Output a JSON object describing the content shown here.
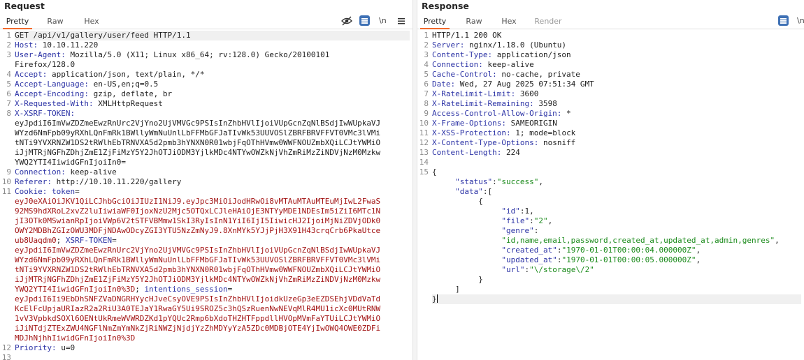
{
  "request": {
    "title": "Request",
    "tabs": [
      "Pretty",
      "Raw",
      "Hex"
    ],
    "active_tab": "Pretty",
    "tools": {
      "newline_label": "\\n"
    },
    "lines": [
      {
        "n": "1",
        "parts": [
          {
            "t": "GET /api/v1/gallery/user/feed HTTP/1.1",
            "c": "v"
          }
        ],
        "hl": true
      },
      {
        "n": "2",
        "parts": [
          {
            "t": "Host:",
            "c": "k"
          },
          {
            "t": " 10.10.11.220",
            "c": "v"
          }
        ]
      },
      {
        "n": "3",
        "parts": [
          {
            "t": "User-Agent:",
            "c": "k"
          },
          {
            "t": " Mozilla/5.0 (X11; Linux x86_64; rv:128.0) Gecko/20100101",
            "c": "v"
          }
        ]
      },
      {
        "n": "",
        "parts": [
          {
            "t": "Firefox/128.0",
            "c": "v"
          }
        ]
      },
      {
        "n": "4",
        "parts": [
          {
            "t": "Accept:",
            "c": "k"
          },
          {
            "t": " application/json, text/plain, */*",
            "c": "v"
          }
        ]
      },
      {
        "n": "5",
        "parts": [
          {
            "t": "Accept-Language:",
            "c": "k"
          },
          {
            "t": " en-US,en;q=0.5",
            "c": "v"
          }
        ]
      },
      {
        "n": "6",
        "parts": [
          {
            "t": "Accept-Encoding:",
            "c": "k"
          },
          {
            "t": " gzip, deflate, br",
            "c": "v"
          }
        ]
      },
      {
        "n": "7",
        "parts": [
          {
            "t": "X-Requested-With:",
            "c": "k"
          },
          {
            "t": " XMLHttpRequest",
            "c": "v"
          }
        ]
      },
      {
        "n": "8",
        "parts": [
          {
            "t": "X-XSRF-TOKEN:",
            "c": "k"
          }
        ]
      },
      {
        "n": "",
        "parts": [
          {
            "t": "eyJpdiI6ImVwZDZmeEwzRnUrc2VjYno2UjVMVGc9PSIsInZhbHVlIjoiVUpGcnZqNlBSdjIwWUpkaVJ",
            "c": "v"
          }
        ]
      },
      {
        "n": "",
        "parts": [
          {
            "t": "WYzd6NmFpb09yRXhLQnFmRk1BWllyWmNuUnlLbFFMbGFJaTIvWk53UUVOSlZBRFBRVFFVT0VMc3lVMi",
            "c": "v"
          }
        ]
      },
      {
        "n": "",
        "parts": [
          {
            "t": "tNTi9YVXRNZW1DS2tRWlhEbTRNVXA5d2pmb3hYNXN0R01wbjFqOThHVmw0WWFNOUZmbXQiLCJtYWMiO",
            "c": "v"
          }
        ]
      },
      {
        "n": "",
        "parts": [
          {
            "t": "iJjMTRjNGFhZDhjZmE1ZjFiMzY5Y2JhOTJiODM3YjlkMDc4NTYwOWZkNjVhZmRiMzZiNDVjNzM0Mzkw",
            "c": "v"
          }
        ]
      },
      {
        "n": "",
        "parts": [
          {
            "t": "YWQ2YTI4IiwidGFnIjoiIn0=",
            "c": "v"
          }
        ]
      },
      {
        "n": "9",
        "parts": [
          {
            "t": "Connection:",
            "c": "k"
          },
          {
            "t": " keep-alive",
            "c": "v"
          }
        ]
      },
      {
        "n": "10",
        "parts": [
          {
            "t": "Referer:",
            "c": "k"
          },
          {
            "t": " http://10.10.11.220/gallery",
            "c": "v"
          }
        ]
      },
      {
        "n": "11",
        "parts": [
          {
            "t": "Cookie:",
            "c": "k"
          },
          {
            "t": " token",
            "c": "k"
          },
          {
            "t": "=",
            "c": "v"
          }
        ]
      },
      {
        "n": "",
        "parts": [
          {
            "t": "eyJ0eXAiOiJKV1QiLCJhbGciOiJIUzI1NiJ9.eyJpc3MiOiJodHRwOi8vMTAuMTAuMTEuMjIwL2FwaS",
            "c": "red"
          }
        ]
      },
      {
        "n": "",
        "parts": [
          {
            "t": "92MS9hdXRoL2xvZ2luIiwiaWF0IjoxNzU2Mjc5OTQxLCJleHAiOjE3NTYyMDE1NDEsIm5iZiI6MTc1N",
            "c": "red"
          }
        ]
      },
      {
        "n": "",
        "parts": [
          {
            "t": "jI3OTk0MSwianRpIjoiVWp6V2tSTFVBMmw1SkI3RyIsInN1YiI6IjI5IiwicHJ2IjoiMjNiZDVjODk0",
            "c": "red"
          }
        ]
      },
      {
        "n": "",
        "parts": [
          {
            "t": "OWY2MDBhZGIzOWU3MDFjNDAwODcyZGI3YTU5NzZmNyJ9.8XnMYk5YJjPjH3X91H43crqCrb6PkaUtce",
            "c": "red"
          }
        ]
      },
      {
        "n": "",
        "parts": [
          {
            "t": "ub8Uaqdm0",
            "c": "red"
          },
          {
            "t": "; ",
            "c": "v"
          },
          {
            "t": "XSRF-TOKEN",
            "c": "k"
          },
          {
            "t": "=",
            "c": "v"
          }
        ]
      },
      {
        "n": "",
        "parts": [
          {
            "t": "eyJpdiI6ImVwZDZmeEwzRnUrc2VjYno2UjVMVGc9PSIsInZhbHVlIjoiVUpGcnZqNlBSdjIwWUpkaVJ",
            "c": "red"
          }
        ]
      },
      {
        "n": "",
        "parts": [
          {
            "t": "WYzd6NmFpb09yRXhLQnFmRk1BWllyWmNuUnlLbFFMbGFJaTIvWk53UUVOSlZBRFBRVFFVT0VMc3lVMi",
            "c": "red"
          }
        ]
      },
      {
        "n": "",
        "parts": [
          {
            "t": "tNTi9YVXRNZW1DS2tRWlhEbTRNVXA5d2pmb3hYNXN0R01wbjFqOThHVmw0WWFNOUZmbXQiLCJtYWMiO",
            "c": "red"
          }
        ]
      },
      {
        "n": "",
        "parts": [
          {
            "t": "iJjMTRjNGFhZDhjZmE1ZjFiMzY5Y2JhOTJiODM3YjlkMDc4NTYwOWZkNjVhZmRiMzZiNDVjNzM0Mzkw",
            "c": "red"
          }
        ]
      },
      {
        "n": "",
        "parts": [
          {
            "t": "YWQ2YTI4IiwidGFnIjoiIn0%3D",
            "c": "red"
          },
          {
            "t": "; ",
            "c": "v"
          },
          {
            "t": "intentions_session",
            "c": "k"
          },
          {
            "t": "=",
            "c": "v"
          }
        ]
      },
      {
        "n": "",
        "parts": [
          {
            "t": "eyJpdiI6Ii9EbDhSNFZVaDNGRHYycHJveCsyOVE9PSIsInZhbHVlIjoidkUzeGp3eEZDSEhjVDdVaTd",
            "c": "red"
          }
        ]
      },
      {
        "n": "",
        "parts": [
          {
            "t": "KcElFcUpjaURIazR2a2RiU3A0TEJaY1RwaGY5Ui9SROZ5c3hQSzRuenNwNEVqMlR4MU1icXc0MUtRNW",
            "c": "red"
          }
        ]
      },
      {
        "n": "",
        "parts": [
          {
            "t": "1vV3VpbkdSOXl6OENtUkRmeWVWRDZKd1pYQUc2Rmp6bXdoTHZHTFppdllHVOpMVmFaYTUiLCJtYWMiO",
            "c": "red"
          }
        ]
      },
      {
        "n": "",
        "parts": [
          {
            "t": "iJiNTdjZTExZWU4NGFlNmZmYmNkZjRiNWZjNjdjYzZhMDYyYzA5ZDc0MDBjOTE4YjIwOWQ4OWE0ZDFi",
            "c": "red"
          }
        ]
      },
      {
        "n": "",
        "parts": [
          {
            "t": "MDJhNjhhIiwidGFnIjoiIn0%3D",
            "c": "red"
          }
        ]
      },
      {
        "n": "12",
        "parts": [
          {
            "t": "Priority:",
            "c": "k"
          },
          {
            "t": " u=0",
            "c": "v"
          }
        ]
      },
      {
        "n": "13",
        "parts": [
          {
            "t": "",
            "c": "v"
          }
        ]
      }
    ]
  },
  "response": {
    "title": "Response",
    "tabs": [
      "Pretty",
      "Raw",
      "Hex",
      "Render"
    ],
    "active_tab": "Pretty",
    "tools": {
      "newline_label": "\\n"
    },
    "lines": [
      {
        "n": "1",
        "parts": [
          {
            "t": "HTTP/1.1 200 OK",
            "c": "v"
          }
        ]
      },
      {
        "n": "2",
        "parts": [
          {
            "t": "Server:",
            "c": "k"
          },
          {
            "t": " nginx/1.18.0 (Ubuntu)",
            "c": "v"
          }
        ]
      },
      {
        "n": "3",
        "parts": [
          {
            "t": "Content-Type:",
            "c": "k"
          },
          {
            "t": " application/json",
            "c": "v"
          }
        ]
      },
      {
        "n": "4",
        "parts": [
          {
            "t": "Connection:",
            "c": "k"
          },
          {
            "t": " keep-alive",
            "c": "v"
          }
        ]
      },
      {
        "n": "5",
        "parts": [
          {
            "t": "Cache-Control:",
            "c": "k"
          },
          {
            "t": " no-cache, private",
            "c": "v"
          }
        ]
      },
      {
        "n": "6",
        "parts": [
          {
            "t": "Date:",
            "c": "k"
          },
          {
            "t": " Wed, 27 Aug 2025 07:51:34 GMT",
            "c": "v"
          }
        ]
      },
      {
        "n": "7",
        "parts": [
          {
            "t": "X-RateLimit-Limit:",
            "c": "k"
          },
          {
            "t": " 3600",
            "c": "v"
          }
        ]
      },
      {
        "n": "8",
        "parts": [
          {
            "t": "X-RateLimit-Remaining:",
            "c": "k"
          },
          {
            "t": " 3598",
            "c": "v"
          }
        ]
      },
      {
        "n": "9",
        "parts": [
          {
            "t": "Access-Control-Allow-Origin:",
            "c": "k"
          },
          {
            "t": " *",
            "c": "v"
          }
        ]
      },
      {
        "n": "10",
        "parts": [
          {
            "t": "X-Frame-Options:",
            "c": "k"
          },
          {
            "t": " SAMEORIGIN",
            "c": "v"
          }
        ]
      },
      {
        "n": "11",
        "parts": [
          {
            "t": "X-XSS-Protection:",
            "c": "k"
          },
          {
            "t": " 1; mode=block",
            "c": "v"
          }
        ]
      },
      {
        "n": "12",
        "parts": [
          {
            "t": "X-Content-Type-Options:",
            "c": "k"
          },
          {
            "t": " nosniff",
            "c": "v"
          }
        ]
      },
      {
        "n": "13",
        "parts": [
          {
            "t": "Content-Length:",
            "c": "k"
          },
          {
            "t": " 224",
            "c": "v"
          }
        ]
      },
      {
        "n": "14",
        "parts": [
          {
            "t": "",
            "c": "v"
          }
        ]
      },
      {
        "n": "15",
        "parts": [
          {
            "t": "{",
            "c": "v"
          }
        ]
      },
      {
        "n": "",
        "parts": [
          {
            "t": "     ",
            "c": "v"
          },
          {
            "t": "\"status\"",
            "c": "jk"
          },
          {
            "t": ":",
            "c": "v"
          },
          {
            "t": "\"success\"",
            "c": "str"
          },
          {
            "t": ",",
            "c": "v"
          }
        ]
      },
      {
        "n": "",
        "parts": [
          {
            "t": "     ",
            "c": "v"
          },
          {
            "t": "\"data\"",
            "c": "jk"
          },
          {
            "t": ":[",
            "c": "v"
          }
        ]
      },
      {
        "n": "",
        "parts": [
          {
            "t": "          {",
            "c": "v"
          }
        ]
      },
      {
        "n": "",
        "parts": [
          {
            "t": "               ",
            "c": "v"
          },
          {
            "t": "\"id\"",
            "c": "jk"
          },
          {
            "t": ":1,",
            "c": "v"
          }
        ]
      },
      {
        "n": "",
        "parts": [
          {
            "t": "               ",
            "c": "v"
          },
          {
            "t": "\"file\"",
            "c": "jk"
          },
          {
            "t": ":",
            "c": "v"
          },
          {
            "t": "\"2\"",
            "c": "str"
          },
          {
            "t": ",",
            "c": "v"
          }
        ]
      },
      {
        "n": "",
        "parts": [
          {
            "t": "               ",
            "c": "v"
          },
          {
            "t": "\"genre\"",
            "c": "jk"
          },
          {
            "t": ":",
            "c": "v"
          }
        ]
      },
      {
        "n": "",
        "parts": [
          {
            "t": "               ",
            "c": "v"
          },
          {
            "t": "\"id,name,email,password,created_at,updated_at,admin,genres\"",
            "c": "str"
          },
          {
            "t": ",",
            "c": "v"
          }
        ]
      },
      {
        "n": "",
        "parts": [
          {
            "t": "               ",
            "c": "v"
          },
          {
            "t": "\"created_at\"",
            "c": "jk"
          },
          {
            "t": ":",
            "c": "v"
          },
          {
            "t": "\"1970-01-01T00:00:04.000000Z\"",
            "c": "str"
          },
          {
            "t": ",",
            "c": "v"
          }
        ]
      },
      {
        "n": "",
        "parts": [
          {
            "t": "               ",
            "c": "v"
          },
          {
            "t": "\"updated_at\"",
            "c": "jk"
          },
          {
            "t": ":",
            "c": "v"
          },
          {
            "t": "\"1970-01-01T00:00:05.000000Z\"",
            "c": "str"
          },
          {
            "t": ",",
            "c": "v"
          }
        ]
      },
      {
        "n": "",
        "parts": [
          {
            "t": "               ",
            "c": "v"
          },
          {
            "t": "\"url\"",
            "c": "jk"
          },
          {
            "t": ":",
            "c": "v"
          },
          {
            "t": "\"\\/storage\\/2\"",
            "c": "str"
          }
        ]
      },
      {
        "n": "",
        "parts": [
          {
            "t": "          }",
            "c": "v"
          }
        ]
      },
      {
        "n": "",
        "parts": [
          {
            "t": "     ]",
            "c": "v"
          }
        ]
      },
      {
        "n": "",
        "parts": [
          {
            "t": "}",
            "c": "v"
          }
        ],
        "cursor": true,
        "hl": true
      }
    ]
  }
}
